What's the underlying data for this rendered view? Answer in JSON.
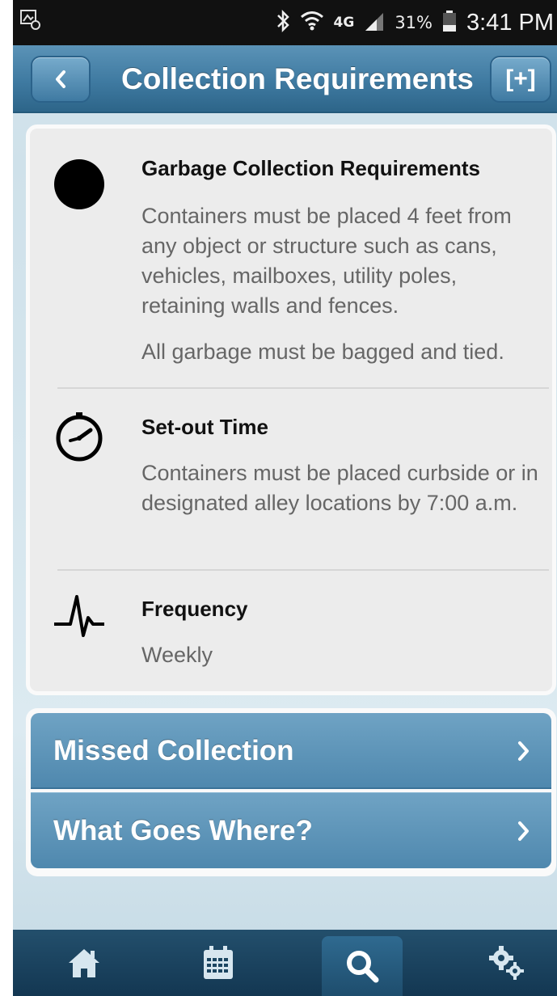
{
  "status_bar": {
    "battery_percent": "31%",
    "time": "3:41 PM",
    "network": "4G"
  },
  "header": {
    "title": "Collection Requirements",
    "add_label": "[+]"
  },
  "requirements": [
    {
      "icon": "circle-icon",
      "title": "Garbage Collection Requirements",
      "paragraphs": [
        "Containers must be placed 4 feet from any object or structure such as cans, vehicles, mailboxes, utility poles, retaining walls and fences.",
        "All garbage must be bagged and tied."
      ]
    },
    {
      "icon": "clock-icon",
      "title": "Set-out Time",
      "paragraphs": [
        "Containers must be placed curbside or in designated alley locations by 7:00 a.m."
      ]
    },
    {
      "icon": "pulse-icon",
      "title": "Frequency",
      "paragraphs": [
        "Weekly"
      ]
    }
  ],
  "nav_items": [
    {
      "label": "Missed Collection"
    },
    {
      "label": "What Goes Where?"
    }
  ],
  "tabs": [
    {
      "name": "home",
      "icon": "home-icon"
    },
    {
      "name": "calendar",
      "icon": "calendar-icon"
    },
    {
      "name": "search",
      "icon": "search-icon",
      "active": true
    },
    {
      "name": "settings",
      "icon": "settings-gears-icon"
    }
  ],
  "colors": {
    "header": "#3f7aa1",
    "nav_item": "#5f97bb",
    "tabbar": "#1b4561"
  }
}
